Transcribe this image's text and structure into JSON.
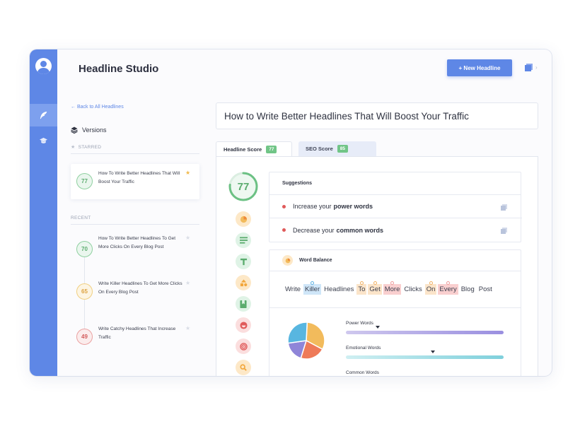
{
  "app": {
    "title": "Headline Studio",
    "new_button": "+ New Headline"
  },
  "sidebar_left": {
    "back_link": "← Back to All Headlines",
    "versions_label": "Versions",
    "starred_label": "STARRED",
    "starred_item": {
      "score": "77",
      "title": "How To Write Better Headlines That Will Boost Your Traffic",
      "starred": true
    },
    "recent_label": "RECENT",
    "recent_items": [
      {
        "score": "70",
        "title": "How To Write Better Headlines To Get More Clicks On Every Blog Post",
        "tone": "green"
      },
      {
        "score": "65",
        "title": "Write Killer Headlines To Get More Clicks On Every Blog Post",
        "tone": "yellow"
      },
      {
        "score": "49",
        "title": "Write Catchy Headlines That Increase Traffic",
        "tone": "red"
      }
    ]
  },
  "editor": {
    "headline": "How to Write Better Headlines That Will Boost Your Traffic",
    "tabs": [
      {
        "label": "Headline Score",
        "badge": "77",
        "active": true
      },
      {
        "label": "SEO Score",
        "badge": "85",
        "active": false
      }
    ],
    "score": {
      "value": "77",
      "fraction": 0.77
    }
  },
  "suggestions": {
    "title": "Suggestions",
    "items": [
      {
        "prefix": "Increase your",
        "bold": "power words"
      },
      {
        "prefix": "Decrease your",
        "bold": "common words"
      }
    ]
  },
  "word_balance": {
    "title": "Word Balance",
    "words": [
      {
        "text": "Write",
        "type": "none"
      },
      {
        "text": "Killer",
        "type": "power"
      },
      {
        "text": "Headlines",
        "type": "none"
      },
      {
        "text": "To",
        "type": "common"
      },
      {
        "text": "Get",
        "type": "common"
      },
      {
        "text": "More",
        "type": "emotional"
      },
      {
        "text": "Clicks",
        "type": "none"
      },
      {
        "text": "On",
        "type": "common"
      },
      {
        "text": "Every",
        "type": "emotional"
      },
      {
        "text": "Blog",
        "type": "none"
      },
      {
        "text": "Post",
        "type": "none"
      }
    ],
    "pie": [
      {
        "name": "yellow",
        "value": 0.32,
        "color": "#f2bb5c"
      },
      {
        "name": "orange",
        "value": 0.22,
        "color": "#ee7a58"
      },
      {
        "name": "purple",
        "value": 0.18,
        "color": "#8f85d8"
      },
      {
        "name": "blue",
        "value": 0.28,
        "color": "#58b6e0"
      }
    ],
    "bars": [
      {
        "label": "Power Words",
        "marker": 0.2
      },
      {
        "label": "Emotional Words",
        "marker": 0.55
      },
      {
        "label": "Common Words"
      }
    ]
  },
  "colors": {
    "brand": "#5e87e6",
    "good": "#5bac6e",
    "warn": "#dca240",
    "bad": "#d25b5b"
  }
}
